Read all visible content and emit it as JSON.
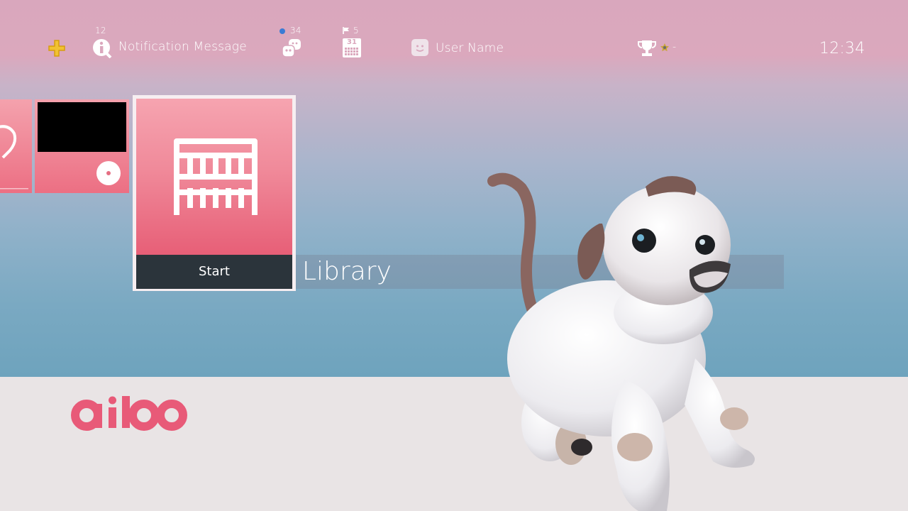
{
  "status_bar": {
    "notifications": {
      "count": "12",
      "message": "Notification Message"
    },
    "friends": {
      "count": "34"
    },
    "events": {
      "count": "5",
      "calendar_day": "31"
    },
    "user": {
      "name": "User Name"
    },
    "trophy": {
      "level_text": "-"
    },
    "clock": "12:34"
  },
  "content": {
    "selected_tile": {
      "action_label": "Start",
      "title": "Library"
    }
  },
  "icons": {
    "plus": "playstation-plus-icon",
    "notification": "info-icon",
    "friends": "friends-icon",
    "events": "calendar-icon",
    "user": "avatar-icon",
    "trophy": "trophy-icon",
    "disc": "disc-icon",
    "library": "library-shelf-icon"
  },
  "colors": {
    "tile_pink_top": "#f6a4b0",
    "tile_pink_bottom": "#e75f77",
    "start_bar": "#2b343b",
    "brand": "#e85a78"
  }
}
